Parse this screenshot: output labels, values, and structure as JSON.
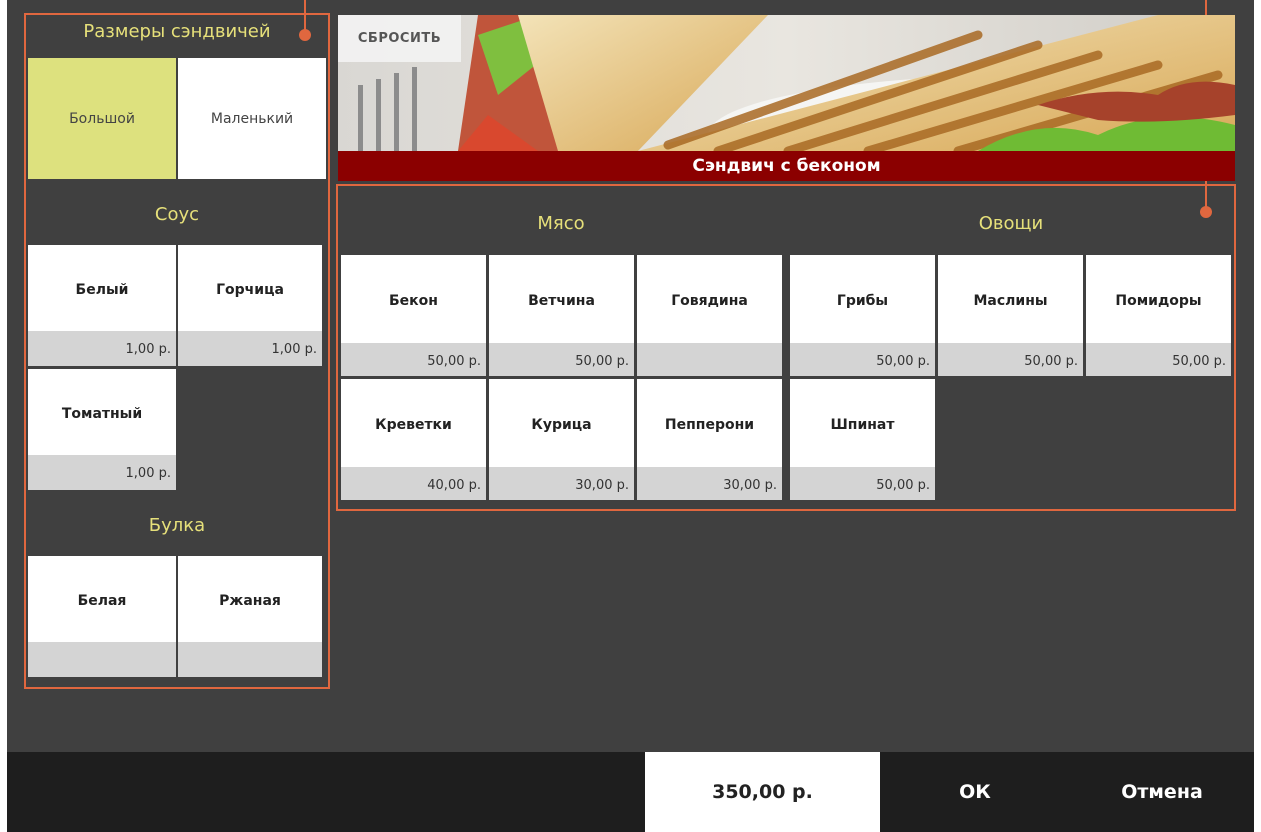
{
  "reset_label": "СБРОСИТЬ",
  "product_title": "Сэндвич с беконом",
  "sizes": {
    "title": "Размеры сэндвичей",
    "items": [
      {
        "label": "Большой",
        "selected": true
      },
      {
        "label": "Маленький",
        "selected": false
      }
    ]
  },
  "sauce": {
    "title": "Соус",
    "items": [
      {
        "name": "Белый",
        "price": "1,00 р."
      },
      {
        "name": "Горчица",
        "price": "1,00 р."
      },
      {
        "name": "Томатный",
        "price": "1,00 р."
      }
    ]
  },
  "bun": {
    "title": "Булка",
    "items": [
      {
        "name": "Белая",
        "price": ""
      },
      {
        "name": "Ржаная",
        "price": ""
      }
    ]
  },
  "meat": {
    "title": "Мясо",
    "items": [
      {
        "name": "Бекон",
        "price": "50,00 р."
      },
      {
        "name": "Ветчина",
        "price": "50,00 р."
      },
      {
        "name": "Говядина",
        "price": ""
      },
      {
        "name": "Креветки",
        "price": "40,00 р."
      },
      {
        "name": "Курица",
        "price": "30,00 р."
      },
      {
        "name": "Пепперони",
        "price": "30,00 р."
      }
    ]
  },
  "veg": {
    "title": "Овощи",
    "items": [
      {
        "name": "Грибы",
        "price": "50,00 р."
      },
      {
        "name": "Маслины",
        "price": "50,00 р."
      },
      {
        "name": "Помидоры",
        "price": "50,00 р."
      },
      {
        "name": "Шпинат",
        "price": "50,00 р."
      }
    ]
  },
  "footer": {
    "total": "350,00 р.",
    "ok": "ОК",
    "cancel": "Отмена"
  },
  "colors": {
    "accent": "#e0673f",
    "selected": "#dde17e",
    "title_bar": "#8b0000",
    "section_title": "#e6e07a"
  }
}
